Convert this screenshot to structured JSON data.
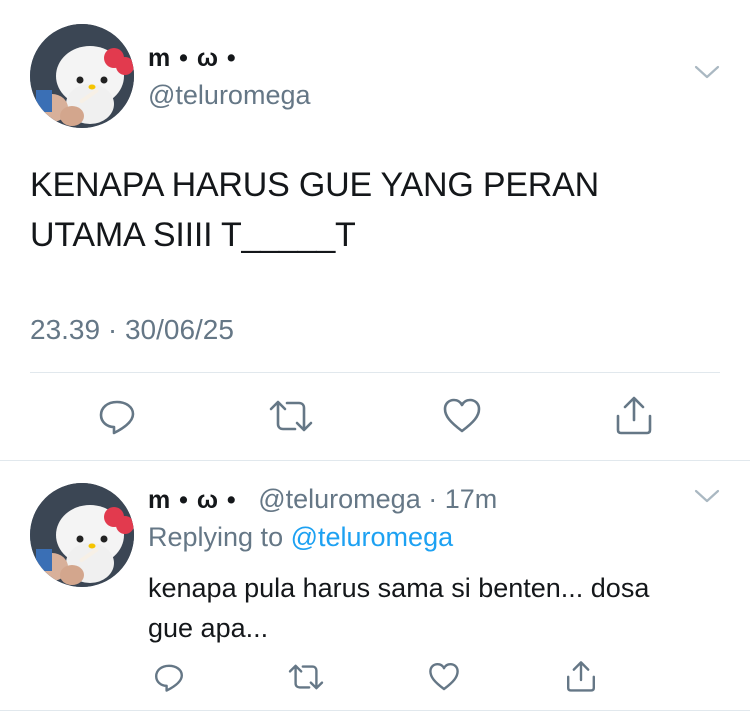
{
  "main_tweet": {
    "display_name": "m • ω •",
    "handle": "@teluromega",
    "text_line1": "KENAPA HARUS GUE YANG PERAN",
    "text_line2": "UTAMA SIIII T_____T",
    "timestamp": "23.39 · 30/06/25"
  },
  "reply_tweet": {
    "display_name": "m • ω •",
    "handle": "@teluromega",
    "age": "· 17m",
    "replying_prefix": "Replying to",
    "replying_handle": "@teluromega",
    "text_line1": "kenapa pula harus sama si benten... dosa",
    "text_line2": "gue apa..."
  },
  "icons": {
    "more": "chevron-down-icon",
    "reply": "reply-icon",
    "retweet": "retweet-icon",
    "like": "heart-icon",
    "share": "share-icon"
  },
  "colors": {
    "text": "#14171a",
    "muted": "#657786",
    "link": "#1da1f2",
    "divider": "#e1e8ed"
  }
}
